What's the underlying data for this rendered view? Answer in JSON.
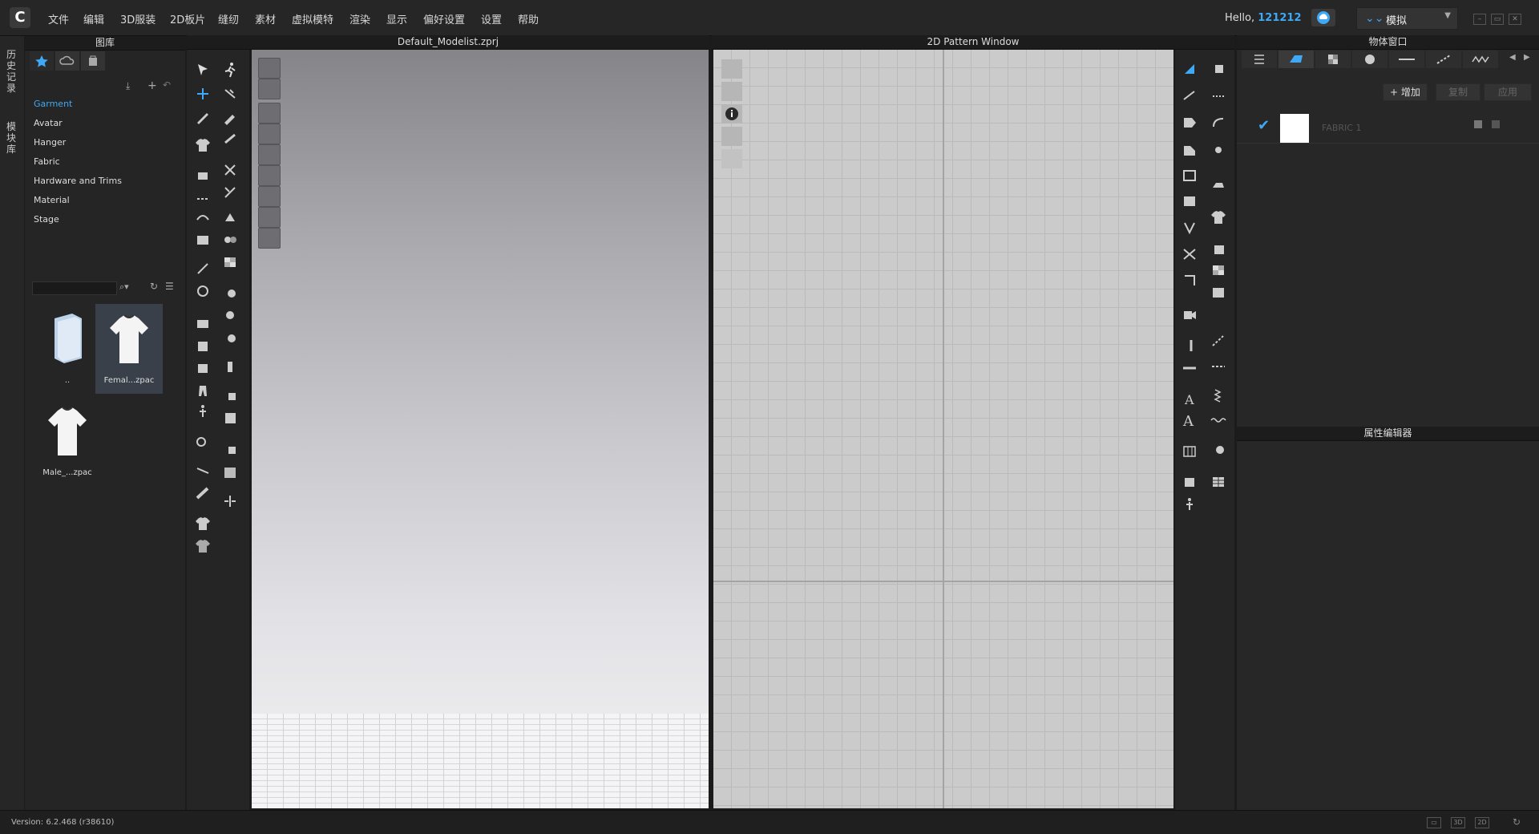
{
  "app": {
    "menu": [
      "文件",
      "编辑",
      "3D服装",
      "2D板片",
      "缝纫",
      "素材",
      "虚拟模特",
      "渲染",
      "显示",
      "偏好设置",
      "设置",
      "帮助"
    ],
    "greeting": "Hello,",
    "username": "121212",
    "mode": "模拟",
    "accent_color": "#3fa9f5"
  },
  "left_tabs": [
    "历史记录",
    "模块库"
  ],
  "library": {
    "title": "图库",
    "items": [
      "Garment",
      "Avatar",
      "Hanger",
      "Fabric",
      "Hardware and Trims",
      "Material",
      "Stage"
    ],
    "active_item": "Garment",
    "files": [
      {
        "name": "..",
        "icon": "folder-icon"
      },
      {
        "name": "Femal...zpac",
        "icon": "tshirt-icon"
      },
      {
        "name": "Male_...zpac",
        "icon": "tshirt-icon"
      }
    ]
  },
  "viewport3d": {
    "title": "Default_Modelist.zprj"
  },
  "viewport2d": {
    "title": "2D Pattern Window"
  },
  "object_window": {
    "title": "物体窗口",
    "add_label": "增加",
    "copy_label": "复制",
    "apply_label": "应用",
    "fabric_name": "FABRIC 1"
  },
  "property_editor": {
    "title": "属性编辑器"
  },
  "status": {
    "version": "Version: 6.2.468 (r38610)"
  }
}
